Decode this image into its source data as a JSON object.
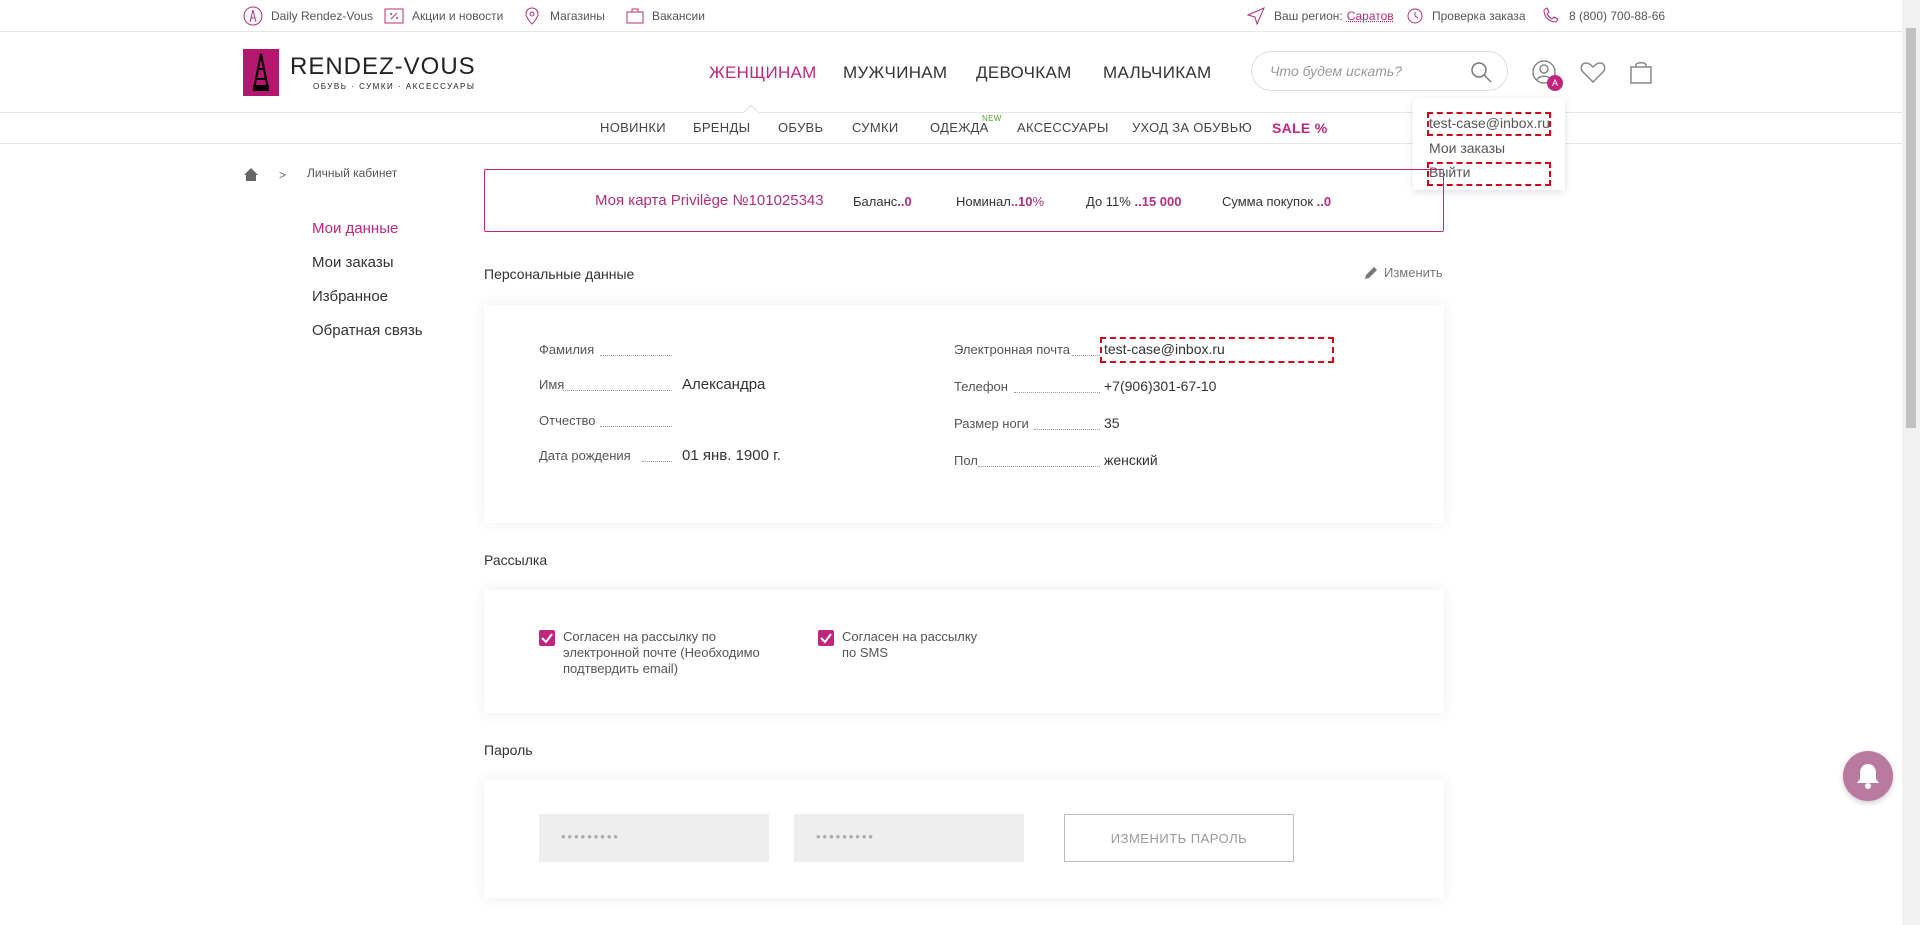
{
  "topbar": {
    "daily": "Daily Rendez-Vous",
    "promo": "Акции и новости",
    "stores": "Магазины",
    "jobs": "Вакансии",
    "region_label": "Ваш регион:",
    "region_value": "Саратов",
    "order_check": "Проверка заказа",
    "phone": "8 (800) 700-88-66"
  },
  "header": {
    "logo_title": "RENDEZ-VOUS",
    "logo_subtitle": "ОБУВЬ · СУМКИ · АКСЕССУАРЫ",
    "nav": [
      "ЖЕНЩИНАМ",
      "МУЖЧИНАМ",
      "ДЕВОЧКАМ",
      "МАЛЬЧИКАМ"
    ],
    "search_placeholder": "Что будем искать?",
    "avatar_badge": "А"
  },
  "subnav": {
    "items": [
      "НОВИНКИ",
      "БРЕНДЫ",
      "ОБУВЬ",
      "СУМКИ",
      "ОДЕЖДА",
      "АКСЕССУАРЫ",
      "УХОД ЗА ОБУВЬЮ",
      "SALE %"
    ],
    "new_tag": "NEW"
  },
  "dropdown": {
    "email": "test-case@inbox.ru",
    "orders": "Мои заказы",
    "logout": "Выйти"
  },
  "breadcrumb": {
    "separator": ">",
    "current": "Личный кабинет"
  },
  "sidebar": [
    "Мои данные",
    "Мои заказы",
    "Избранное",
    "Обратная связь"
  ],
  "card": {
    "title": "Моя карта Privilège №101025343",
    "balance_label": "Баланс",
    "balance_value": "..0",
    "nominal_label": "Номинал",
    "nominal_value": "..10",
    "nominal_unit": "%",
    "upto_label": "До 11%",
    "upto_value": "..15 000",
    "sum_label": "Сумма покупок",
    "sum_value": "..0"
  },
  "personal": {
    "title": "Персональные данные",
    "edit": "Изменить",
    "left": [
      {
        "label": "Фамилия",
        "value": ""
      },
      {
        "label": "Имя",
        "value": "Александра"
      },
      {
        "label": "Отчество",
        "value": ""
      },
      {
        "label": "Дата рождения",
        "value": "01 янв. 1900 г."
      }
    ],
    "right": [
      {
        "label": "Электронная почта",
        "value": "test-case@inbox.ru"
      },
      {
        "label": "Телефон",
        "value": "+7(906)301-67-10"
      },
      {
        "label": "Размер ноги",
        "value": "35"
      },
      {
        "label": "Пол",
        "value": "женский"
      }
    ]
  },
  "newsletter": {
    "title": "Рассылка",
    "email_consent": "Согласен на рассылку по электронной почте (Необходимо подтвердить email)",
    "sms_consent": "Согласен на рассылку по SMS",
    "email_checked": true,
    "sms_checked": true
  },
  "password": {
    "title": "Пароль",
    "field1": "•••••••••",
    "field2": "•••••••••",
    "button": "ИЗМЕНИТЬ ПАРОЛЬ"
  },
  "colors": {
    "accent": "#c2257d",
    "highlight": "#d0021b"
  }
}
